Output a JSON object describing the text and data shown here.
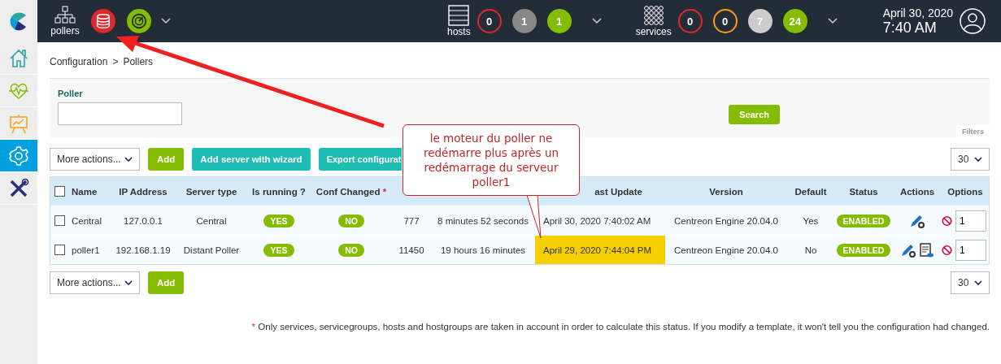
{
  "sidebar": {
    "items": [
      {
        "kind": "home",
        "selected": false
      },
      {
        "kind": "monitoring",
        "selected": false
      },
      {
        "kind": "reporting",
        "selected": false
      },
      {
        "kind": "configuration",
        "selected": true
      },
      {
        "kind": "administration",
        "selected": false
      }
    ]
  },
  "topbar": {
    "pollers": {
      "label": "pollers",
      "status": [
        {
          "kind": "database",
          "color": "#e3262b"
        },
        {
          "kind": "gauge",
          "color": "#84bd00"
        }
      ]
    },
    "hosts": {
      "label": "hosts",
      "counters": [
        {
          "value": "0",
          "kind": "ring",
          "color": "#e3262b"
        },
        {
          "value": "1",
          "kind": "filled",
          "color": "#888888"
        },
        {
          "value": "1",
          "kind": "filled",
          "color": "#84bd00"
        }
      ]
    },
    "services": {
      "label": "services",
      "counters": [
        {
          "value": "0",
          "kind": "ring",
          "color": "#e3262b"
        },
        {
          "value": "0",
          "kind": "ring",
          "color": "#ff9a13"
        },
        {
          "value": "7",
          "kind": "filled",
          "color": "#cccccc"
        },
        {
          "value": "24",
          "kind": "filled",
          "color": "#84bd00"
        }
      ]
    },
    "date": "April 30, 2020",
    "time": "7:40 AM"
  },
  "breadcrumb": [
    "Configuration",
    ">",
    "Pollers"
  ],
  "filter": {
    "label": "Poller",
    "search_button": "Search",
    "tab": "Filters"
  },
  "toolbar_top": {
    "more_actions": "More actions...",
    "buttons": [
      {
        "label": "Add",
        "kind": "green"
      },
      {
        "label": "Add server with wizard",
        "kind": "teal"
      },
      {
        "label": "Export configurat",
        "kind": "teal"
      }
    ],
    "page_size": "30"
  },
  "table": {
    "select_all_checked": false,
    "columns": [
      {
        "label": "Name"
      },
      {
        "label": "IP Address"
      },
      {
        "label": "Server type"
      },
      {
        "label": "Is running ?"
      },
      {
        "label": "Conf Changed",
        "mark": "*"
      },
      {},
      {},
      {
        "label": "ast Update"
      },
      {
        "label": "Version"
      },
      {
        "label": "Default"
      },
      {
        "label": "Status"
      },
      {
        "label": "Actions"
      },
      {
        "label": "Options"
      }
    ],
    "rows": [
      {
        "checked": false,
        "name": "Central",
        "ip": "127.0.0.1",
        "server_type": "Central",
        "running": "YES",
        "conf_changed": "NO",
        "column_6": "777",
        "column_7": "8 minutes 52 seconds",
        "last_update": "April 30, 2020 7:40:02 AM",
        "highlighted": false,
        "version": "Centreon Engine 20.04.0",
        "default": "Yes",
        "status": "ENABLED",
        "actions": [
          {
            "kind": "edit"
          }
        ],
        "option": "1"
      },
      {
        "checked": false,
        "name": "poller1",
        "ip": "192.168.1.19",
        "server_type": "Distant Poller",
        "running": "YES",
        "conf_changed": "NO",
        "column_6": "11450",
        "column_7": "19 hours 16 minutes",
        "last_update": "April 29, 2020 7:44:04 PM",
        "highlighted": true,
        "version": "Centreon Engine 20.04.0",
        "default": "No",
        "status": "ENABLED",
        "actions": [
          {
            "kind": "edit"
          },
          {
            "kind": "view"
          }
        ],
        "option": "1"
      }
    ]
  },
  "toolbar_bottom": {
    "more_actions": "More actions...",
    "buttons": [
      {
        "label": "Add",
        "kind": "green"
      }
    ],
    "page_size": "30"
  },
  "footnote": {
    "mark": "*",
    "text": "Only services, servicegroups, hosts and hostgroups are taken in account in order to calculate this status. If you modify a template, it won't tell you the configuration had changed."
  },
  "annotation": {
    "text": "le moteur du poller ne redémarre plus après un redémarrage du serveur poller1"
  }
}
